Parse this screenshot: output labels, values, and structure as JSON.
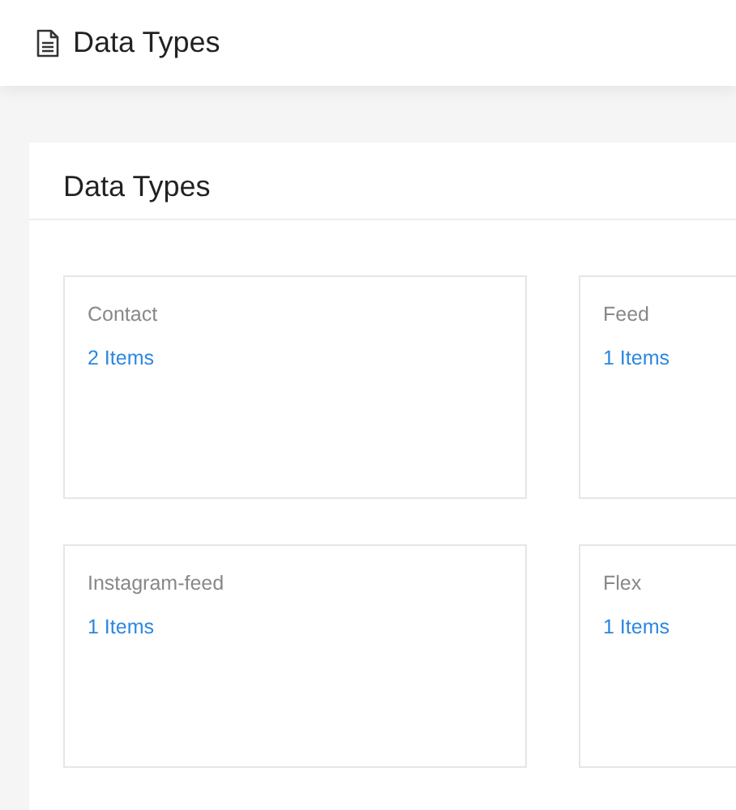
{
  "header": {
    "title": "Data Types"
  },
  "panel": {
    "title": "Data Types",
    "cards": [
      {
        "name": "Contact",
        "count": "2 Items"
      },
      {
        "name": "Feed",
        "count": "1 Items"
      },
      {
        "name": "Instagram-feed",
        "count": "1 Items"
      },
      {
        "name": "Flex",
        "count": "1 Items"
      }
    ]
  }
}
